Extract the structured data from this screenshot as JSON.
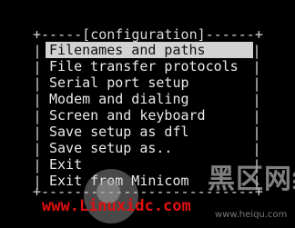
{
  "terminal": {
    "background": "#000000",
    "foreground": "#e9e9e9"
  },
  "config_menu": {
    "top_border": "+-----[configuration]------+",
    "bottom_border": "+--------------------------+",
    "items": [
      {
        "label": "Filenames and paths",
        "selected": true
      },
      {
        "label": "File transfer protocols",
        "selected": false
      },
      {
        "label": "Serial port setup",
        "selected": false
      },
      {
        "label": "Modem and dialing",
        "selected": false
      },
      {
        "label": "Screen and keyboard",
        "selected": false
      },
      {
        "label": "Save setup as dfl",
        "selected": false
      },
      {
        "label": "Save setup as..",
        "selected": false
      },
      {
        "label": "Exit",
        "selected": false
      },
      {
        "label": "Exit from Minicom",
        "selected": false
      }
    ],
    "selected_color": "#d2d2d2"
  },
  "watermark": {
    "url_text": "www.Linuxidc.com",
    "brand_text": "黑区网络",
    "sub_text": "www.heiqu.com",
    "url_color": "#e01010"
  }
}
